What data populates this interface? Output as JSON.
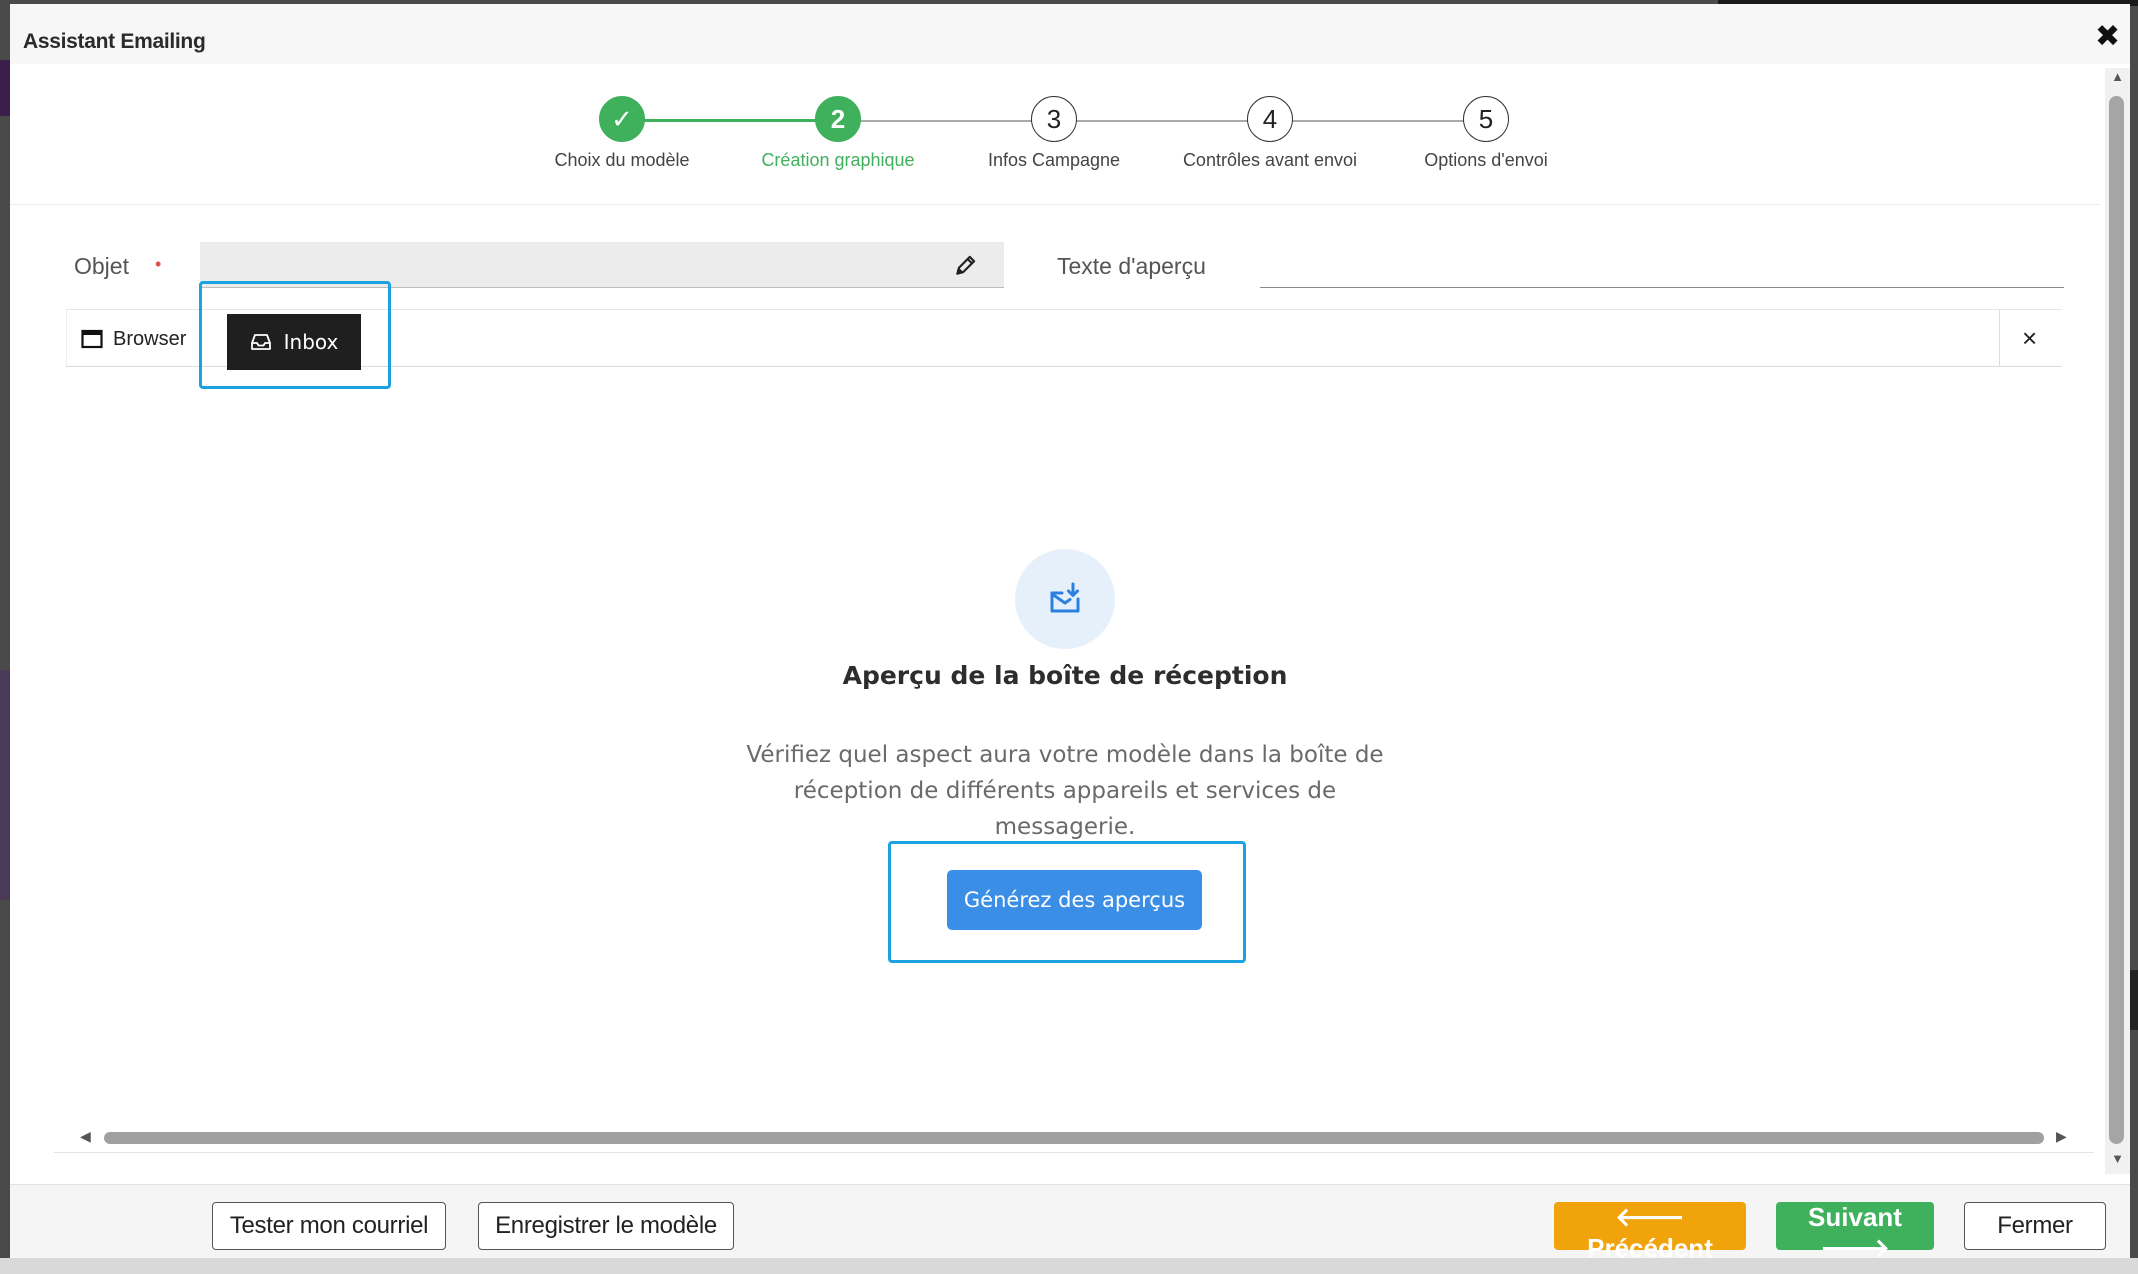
{
  "dialog": {
    "title": "Assistant Emailing",
    "close_icon": "close-icon"
  },
  "stepper": {
    "steps": [
      {
        "number": "✓",
        "label": "Choix du modèle",
        "state": "done"
      },
      {
        "number": "2",
        "label": "Création graphique",
        "state": "active"
      },
      {
        "number": "3",
        "label": "Infos Campagne",
        "state": "todo"
      },
      {
        "number": "4",
        "label": "Contrôles avant envoi",
        "state": "todo"
      },
      {
        "number": "5",
        "label": "Options d'envoi",
        "state": "todo"
      }
    ],
    "colors": {
      "active": "#3fb05b",
      "todo": "#333333"
    }
  },
  "form": {
    "subject_label": "Objet",
    "subject_required_marker": "•",
    "subject_value": "",
    "preview_text_label": "Texte d'aperçu",
    "preview_text_value": ""
  },
  "preview_tabs": {
    "browser_label": "Browser",
    "inbox_label": "Inbox",
    "selected": "Inbox"
  },
  "empty_state": {
    "icon": "mail-download-icon",
    "title": "Aperçu de la boîte de réception",
    "description": "Vérifiez quel aspect aura votre modèle dans la boîte de réception de différents appareils et services de messagerie.",
    "button_label": "Générez des aperçus"
  },
  "footer": {
    "test_label": "Tester mon courriel",
    "save_label": "Enregistrer le modèle",
    "prev_label": "Précédent",
    "next_label": "Suivant",
    "close_label": "Fermer"
  },
  "colors": {
    "highlight": "#1aa3e0",
    "primary_button": "#3b8ee6",
    "prev_button": "#f0a30a",
    "next_button": "#3fb05b"
  }
}
